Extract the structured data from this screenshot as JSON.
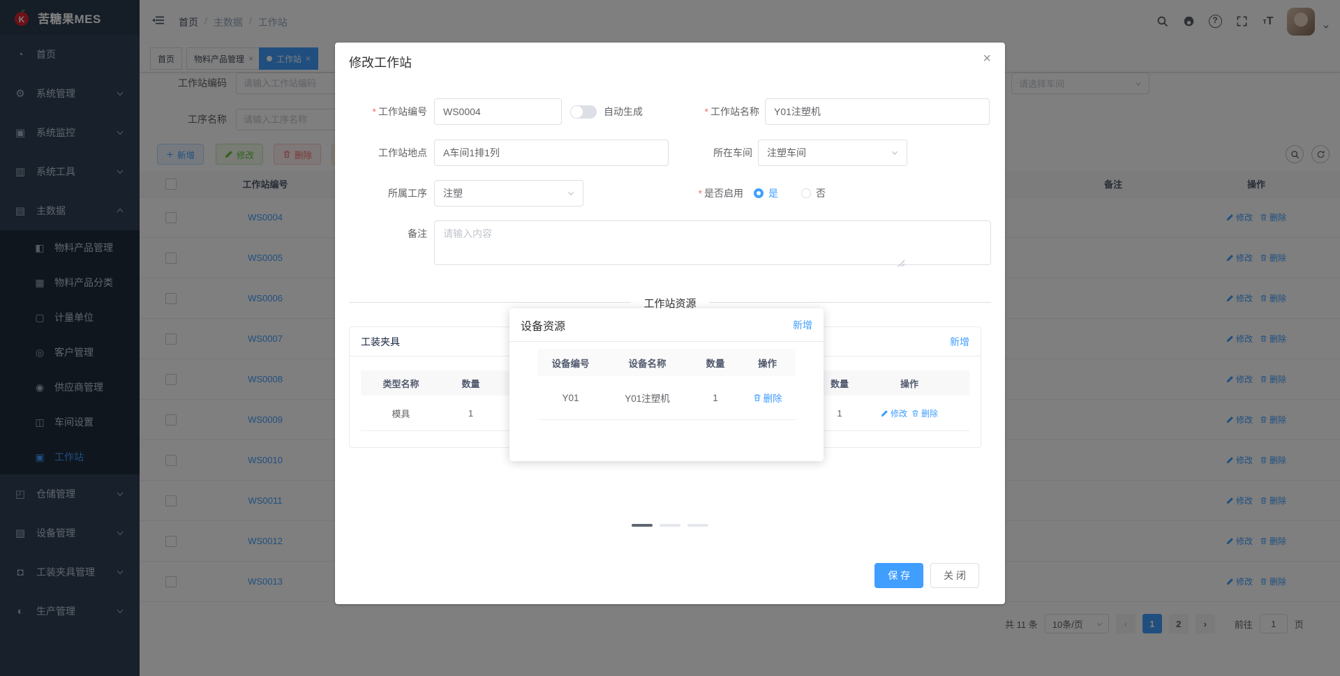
{
  "colors": {
    "primary": "#409EFF",
    "sidebar_bg": "#304156",
    "submenu_bg": "#1f2d3d",
    "success": "#67c23a",
    "danger": "#f56c6c",
    "warning": "#e6a23c"
  },
  "app": {
    "logo_title": "苦糖果MES"
  },
  "navbar": {
    "breadcrumb": {
      "home": "首页",
      "sep": "/",
      "mid": "主数据",
      "cur": "工作站"
    }
  },
  "tabs": {
    "home": "首页",
    "material": "物料产品管理",
    "workstation": "工作站"
  },
  "filters": {
    "code_label": "工作站编码",
    "code_placeholder": "请输入工作站编码",
    "name_label": "工序名称",
    "name_placeholder": "请输入工序名称",
    "workshop_placeholder": "请选择车间"
  },
  "toolbar": {
    "add": "新增",
    "edit": "修改",
    "delete": "删除"
  },
  "table": {
    "header_code": "工作站编号",
    "header_remark": "备注",
    "header_action": "操作",
    "action_edit": "修改",
    "action_delete": "删除",
    "rows": [
      {
        "code": "WS0004"
      },
      {
        "code": "WS0005"
      },
      {
        "code": "WS0006"
      },
      {
        "code": "WS0007"
      },
      {
        "code": "WS0008"
      },
      {
        "code": "WS0009"
      },
      {
        "code": "WS0010"
      },
      {
        "code": "WS0011"
      },
      {
        "code": "WS0012"
      },
      {
        "code": "WS0013"
      }
    ]
  },
  "pagination": {
    "total": "共 11 条",
    "size": "10条/页",
    "prev": "‹",
    "page1": "1",
    "page2": "2",
    "next": "›",
    "jump_label": "前往",
    "jump_value": "1",
    "jump_unit": "页"
  },
  "sidebar": {
    "items": [
      {
        "label": "首页",
        "icon": "dashboard"
      },
      {
        "label": "系统管理",
        "icon": "gear"
      },
      {
        "label": "系统监控",
        "icon": "monitor"
      },
      {
        "label": "系统工具",
        "icon": "toolbox"
      },
      {
        "label": "主数据",
        "icon": "database",
        "children": [
          {
            "label": "物料产品管理",
            "icon": "product"
          },
          {
            "label": "物料产品分类",
            "icon": "category"
          },
          {
            "label": "计量单位",
            "icon": "unit"
          },
          {
            "label": "客户管理",
            "icon": "customer"
          },
          {
            "label": "供应商管理",
            "icon": "supplier"
          },
          {
            "label": "车间设置",
            "icon": "workshop"
          },
          {
            "label": "工作站",
            "icon": "workstation"
          }
        ]
      },
      {
        "label": "仓储管理",
        "icon": "warehouse"
      },
      {
        "label": "设备管理",
        "icon": "equipment"
      },
      {
        "label": "工装夹具管理",
        "icon": "fixture"
      },
      {
        "label": "生产管理",
        "icon": "production"
      }
    ]
  },
  "modal": {
    "title": "修改工作站",
    "required_mark": "*",
    "fields": {
      "code_label": "工作站编号",
      "code_value": "WS0004",
      "auto_label": "自动生成",
      "name_label": "工作站名称",
      "name_value": "Y01注塑机",
      "location_label": "工作站地点",
      "location_value": "A车间1排1列",
      "workshop_label": "所在车间",
      "workshop_value": "注塑车间",
      "process_label": "所属工序",
      "process_value": "注塑",
      "enabled_label": "是否启用",
      "enabled_yes": "是",
      "enabled_no": "否",
      "remark_label": "备注",
      "remark_placeholder": "请输入内容"
    },
    "divider_title": "工作站资源",
    "fixture_panel": {
      "title": "工装夹具",
      "col_type": "类型名称",
      "col_qty": "数量",
      "row_type": "模具",
      "row_qty": "1",
      "row_edit": "修改"
    },
    "equipment_popup": {
      "title": "设备资源",
      "add": "新增",
      "col_code": "设备编号",
      "col_name": "设备名称",
      "col_qty": "数量",
      "col_action": "操作",
      "row_code": "Y01",
      "row_name": "Y01注塑机",
      "row_qty": "1",
      "row_delete": "删除"
    },
    "right_panel": {
      "add": "新增",
      "col_qty": "数量",
      "col_action": "操作",
      "row_qty": "1",
      "row_edit": "修改",
      "row_delete": "删除"
    },
    "footer": {
      "save": "保 存",
      "close": "关 闭"
    }
  }
}
